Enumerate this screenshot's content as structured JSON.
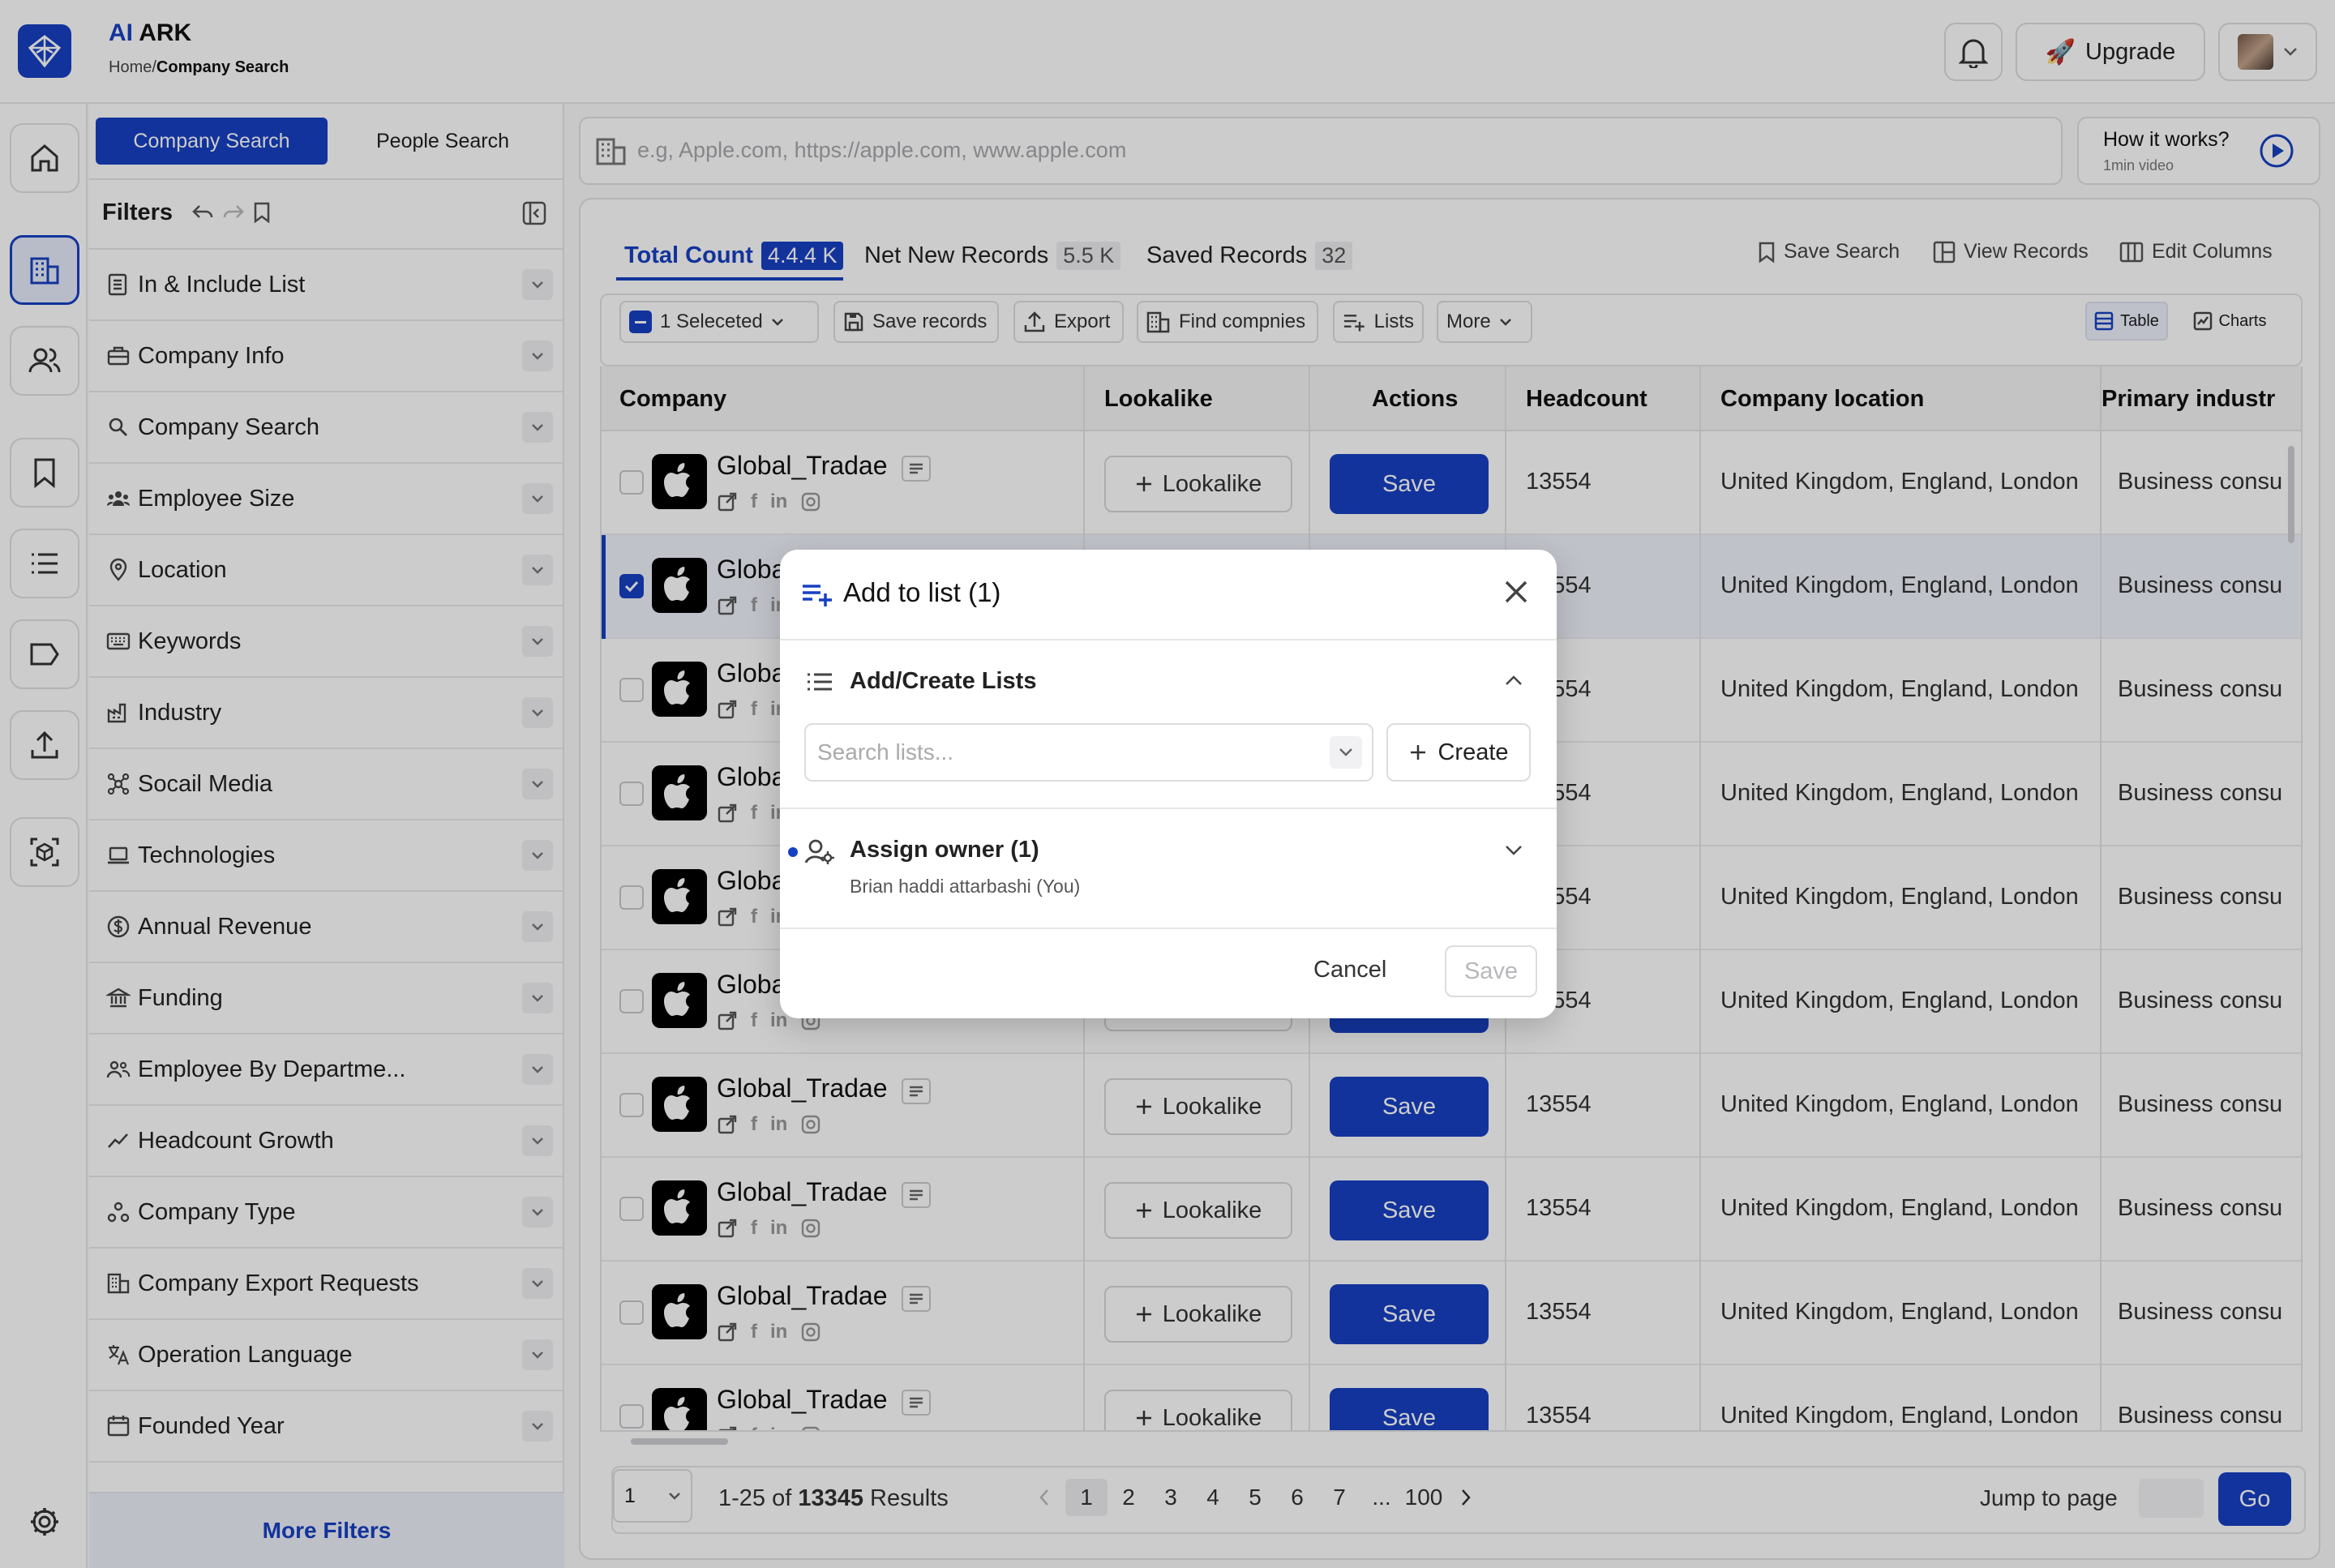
{
  "app": {
    "brand_ai": "AI",
    "brand_rest": " ARK",
    "crumb_home": "Home/",
    "crumb_current": "Company Search"
  },
  "header": {
    "upgrade_label": "Upgrade",
    "upgrade_icon": "rocket-icon"
  },
  "rail": {
    "items": [
      "home-icon",
      "building-icon",
      "people-icon",
      "bookmark-icon",
      "list-icon",
      "tag-icon",
      "upload-icon",
      "cube-scan-icon",
      "gear-icon"
    ],
    "active": "building-icon"
  },
  "search_tabs": {
    "company": "Company Search",
    "people": "People Search"
  },
  "filters": {
    "title": "Filters",
    "items": [
      "In & Include List",
      "Company Info",
      "Company Search",
      "Employee Size",
      "Location",
      "Keywords",
      "Industry",
      "Socail Media",
      "Technologies",
      "Annual Revenue",
      "Funding",
      "Employee By Departme...",
      "Headcount Growth",
      "Company Type",
      "Company Export Requests",
      "Operation Language",
      "Founded Year"
    ],
    "more": "More Filters"
  },
  "search": {
    "placeholder": "e.g, Apple.com, https://apple.com, www.apple.com"
  },
  "how": {
    "title": "How it works?",
    "sub": "1min video"
  },
  "tabs": {
    "total_label": "Total Count",
    "total_count": "4.4.4 K",
    "new_label": "Net New Records",
    "new_count": "5.5 K",
    "saved_label": "Saved Records",
    "saved_count": "32"
  },
  "top_actions": {
    "save_search": "Save Search",
    "view_records": "View Records",
    "edit_columns": "Edit Columns"
  },
  "toolbar": {
    "selected": "1 Seleceted",
    "save_records": "Save records",
    "export": "Export",
    "find": "Find compnies",
    "lists": "Lists",
    "more": "More",
    "table": "Table",
    "charts": "Charts"
  },
  "table": {
    "columns": [
      "Company",
      "Lookalike",
      "Actions",
      "Headcount",
      "Company location",
      "Primary industr"
    ],
    "lookalike_label": "Lookalike",
    "save_label": "Save",
    "rows": [
      {
        "name": "Global_Tradae",
        "headcount": "13554",
        "location": "United Kingdom, England, London",
        "industry": "Business consu",
        "selected": false
      },
      {
        "name": "Global_Tradae",
        "headcount": "13554",
        "location": "United Kingdom, England, London",
        "industry": "Business consu",
        "selected": true
      },
      {
        "name": "Global_Tradae",
        "headcount": "13554",
        "location": "United Kingdom, England, London",
        "industry": "Business consu",
        "selected": false
      },
      {
        "name": "Global_Tradae",
        "headcount": "13554",
        "location": "United Kingdom, England, London",
        "industry": "Business consu",
        "selected": false
      },
      {
        "name": "Global_Tradae",
        "headcount": "13554",
        "location": "United Kingdom, England, London",
        "industry": "Business consu",
        "selected": false
      },
      {
        "name": "Global_Tradae",
        "headcount": "13554",
        "location": "United Kingdom, England, London",
        "industry": "Business consu",
        "selected": false
      },
      {
        "name": "Global_Tradae",
        "headcount": "13554",
        "location": "United Kingdom, England, London",
        "industry": "Business consu",
        "selected": false
      },
      {
        "name": "Global_Tradae",
        "headcount": "13554",
        "location": "United Kingdom, England, London",
        "industry": "Business consu",
        "selected": false
      },
      {
        "name": "Global_Tradae",
        "headcount": "13554",
        "location": "United Kingdom, England, London",
        "industry": "Business consu",
        "selected": false
      },
      {
        "name": "Global_Tradae",
        "headcount": "13554",
        "location": "United Kingdom, England, London",
        "industry": "Business consu",
        "selected": false
      }
    ]
  },
  "pagination": {
    "page_size": "1",
    "range": "1-25 of ",
    "total": "13345",
    "results_word": " Results",
    "pages": [
      "1",
      "2",
      "3",
      "4",
      "5",
      "6",
      "7",
      "...",
      "100"
    ],
    "current": "1",
    "jump_label": "Jump to page",
    "go": "Go"
  },
  "modal": {
    "title": "Add to list (1)",
    "section1": "Add/Create Lists",
    "search_placeholder": "Search lists...",
    "create": "Create",
    "section2": "Assign owner (1)",
    "owner": "Brian haddi attarbashi (You)",
    "cancel": "Cancel",
    "save": "Save"
  },
  "colors": {
    "accent": "#1740c2"
  }
}
